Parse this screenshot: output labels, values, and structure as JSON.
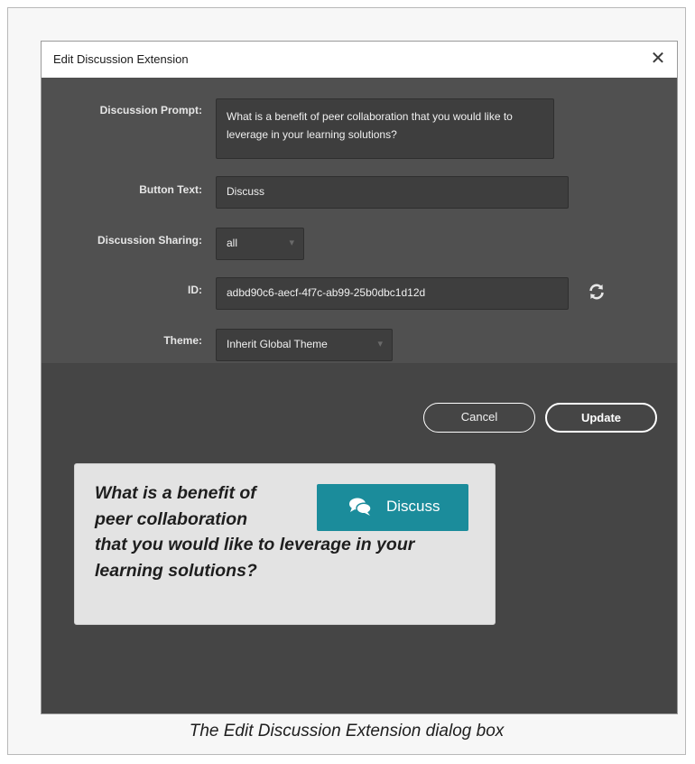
{
  "dialog": {
    "title": "Edit Discussion Extension",
    "close_icon": "close-icon"
  },
  "form": {
    "prompt_label": "Discussion Prompt:",
    "prompt_value": "What is a benefit of peer collaboration that you would like to leverage in your learning solutions?",
    "button_text_label": "Button Text:",
    "button_text_value": "Discuss",
    "sharing_label": "Discussion Sharing:",
    "sharing_value": "all",
    "id_label": "ID:",
    "id_value": "adbd90c6-aecf-4f7c-ab99-25b0dbc1d12d",
    "refresh_icon": "refresh-icon",
    "theme_label": "Theme:",
    "theme_value": "Inherit Global Theme"
  },
  "actions": {
    "cancel_label": "Cancel",
    "update_label": "Update"
  },
  "preview": {
    "lines": [
      "What is a benefit of",
      "peer collaboration",
      "that you would like to leverage in your",
      "learning solutions?"
    ],
    "button_label": "Discuss",
    "button_icon": "chat-bubbles-icon"
  },
  "caption": "The Edit Discussion Extension dialog box",
  "colors": {
    "dialog_bg": "#505050",
    "field_bg": "#3e3e3e",
    "preview_bg": "#e3e3e3",
    "accent": "#1b8c9b"
  }
}
